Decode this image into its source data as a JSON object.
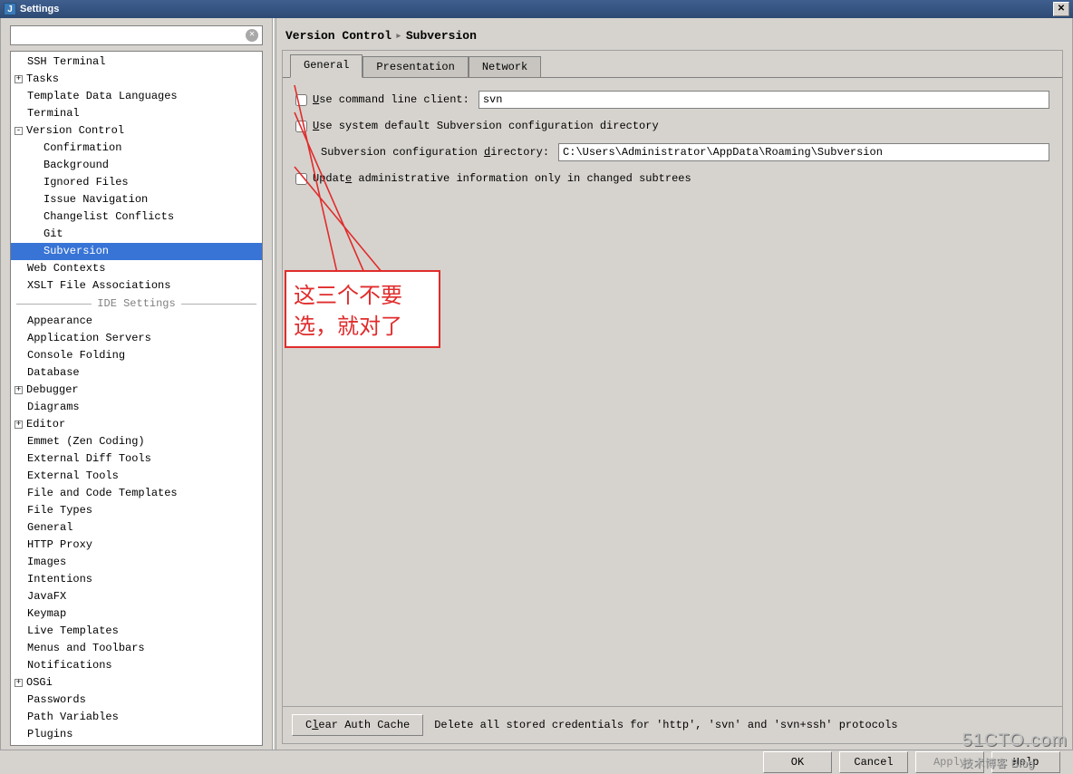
{
  "window": {
    "title": "Settings",
    "close": "✕"
  },
  "search": {
    "placeholder": ""
  },
  "tree": {
    "items": [
      {
        "label": "SSH Terminal",
        "depth": 0,
        "toggle": null
      },
      {
        "label": "Tasks",
        "depth": 0,
        "toggle": "+"
      },
      {
        "label": "Template Data Languages",
        "depth": 0,
        "toggle": null
      },
      {
        "label": "Terminal",
        "depth": 0,
        "toggle": null
      },
      {
        "label": "Version Control",
        "depth": 0,
        "toggle": "-"
      },
      {
        "label": "Confirmation",
        "depth": 1,
        "toggle": null
      },
      {
        "label": "Background",
        "depth": 1,
        "toggle": null
      },
      {
        "label": "Ignored Files",
        "depth": 1,
        "toggle": null
      },
      {
        "label": "Issue Navigation",
        "depth": 1,
        "toggle": null
      },
      {
        "label": "Changelist Conflicts",
        "depth": 1,
        "toggle": null
      },
      {
        "label": "Git",
        "depth": 1,
        "toggle": null
      },
      {
        "label": "Subversion",
        "depth": 1,
        "toggle": null,
        "selected": true
      },
      {
        "label": "Web Contexts",
        "depth": 0,
        "toggle": null
      },
      {
        "label": "XSLT File Associations",
        "depth": 0,
        "toggle": null
      },
      {
        "separator": "IDE Settings"
      },
      {
        "label": "Appearance",
        "depth": 0,
        "toggle": null
      },
      {
        "label": "Application Servers",
        "depth": 0,
        "toggle": null
      },
      {
        "label": "Console Folding",
        "depth": 0,
        "toggle": null
      },
      {
        "label": "Database",
        "depth": 0,
        "toggle": null
      },
      {
        "label": "Debugger",
        "depth": 0,
        "toggle": "+"
      },
      {
        "label": "Diagrams",
        "depth": 0,
        "toggle": null
      },
      {
        "label": "Editor",
        "depth": 0,
        "toggle": "+"
      },
      {
        "label": "Emmet (Zen Coding)",
        "depth": 0,
        "toggle": null
      },
      {
        "label": "External Diff Tools",
        "depth": 0,
        "toggle": null
      },
      {
        "label": "External Tools",
        "depth": 0,
        "toggle": null
      },
      {
        "label": "File and Code Templates",
        "depth": 0,
        "toggle": null
      },
      {
        "label": "File Types",
        "depth": 0,
        "toggle": null
      },
      {
        "label": "General",
        "depth": 0,
        "toggle": null
      },
      {
        "label": "HTTP Proxy",
        "depth": 0,
        "toggle": null
      },
      {
        "label": "Images",
        "depth": 0,
        "toggle": null
      },
      {
        "label": "Intentions",
        "depth": 0,
        "toggle": null
      },
      {
        "label": "JavaFX",
        "depth": 0,
        "toggle": null
      },
      {
        "label": "Keymap",
        "depth": 0,
        "toggle": null
      },
      {
        "label": "Live Templates",
        "depth": 0,
        "toggle": null
      },
      {
        "label": "Menus and Toolbars",
        "depth": 0,
        "toggle": null
      },
      {
        "label": "Notifications",
        "depth": 0,
        "toggle": null
      },
      {
        "label": "OSGi",
        "depth": 0,
        "toggle": "+"
      },
      {
        "label": "Passwords",
        "depth": 0,
        "toggle": null
      },
      {
        "label": "Path Variables",
        "depth": 0,
        "toggle": null
      },
      {
        "label": "Plugins",
        "depth": 0,
        "toggle": null
      }
    ]
  },
  "breadcrumb": {
    "a": "Version Control",
    "b": "Subversion"
  },
  "tabs": {
    "general": "General",
    "presentation": "Presentation",
    "network": "Network"
  },
  "form": {
    "cmdline_pre": "U",
    "cmdline_label": "se command line client:",
    "cmdline_value": "svn",
    "usesys_pre": "U",
    "usesys_label": "se system default Subversion configuration directory",
    "confdir_label_a": "Subversion configuration ",
    "confdir_u": "d",
    "confdir_label_b": "irectory:",
    "confdir_value": "C:\\Users\\Administrator\\AppData\\Roaming\\Subversion",
    "update_a": "Updat",
    "update_u": "e",
    "update_b": " administrative information only in changed subtrees"
  },
  "clear_auth": {
    "btn_pre": "C",
    "btn_u": "l",
    "btn_post": "ear Auth Cache",
    "desc": "Delete all stored credentials for 'http', 'svn' and 'svn+ssh' protocols"
  },
  "footer": {
    "ok": "OK",
    "cancel": "Cancel",
    "apply": "Apply",
    "help": "Help"
  },
  "annotation": {
    "line1": "这三个不要",
    "line2": "选，就对了"
  },
  "watermark": {
    "a": "51CTO",
    "b": ".com",
    "c": "技术博客",
    "d": "Blog"
  }
}
